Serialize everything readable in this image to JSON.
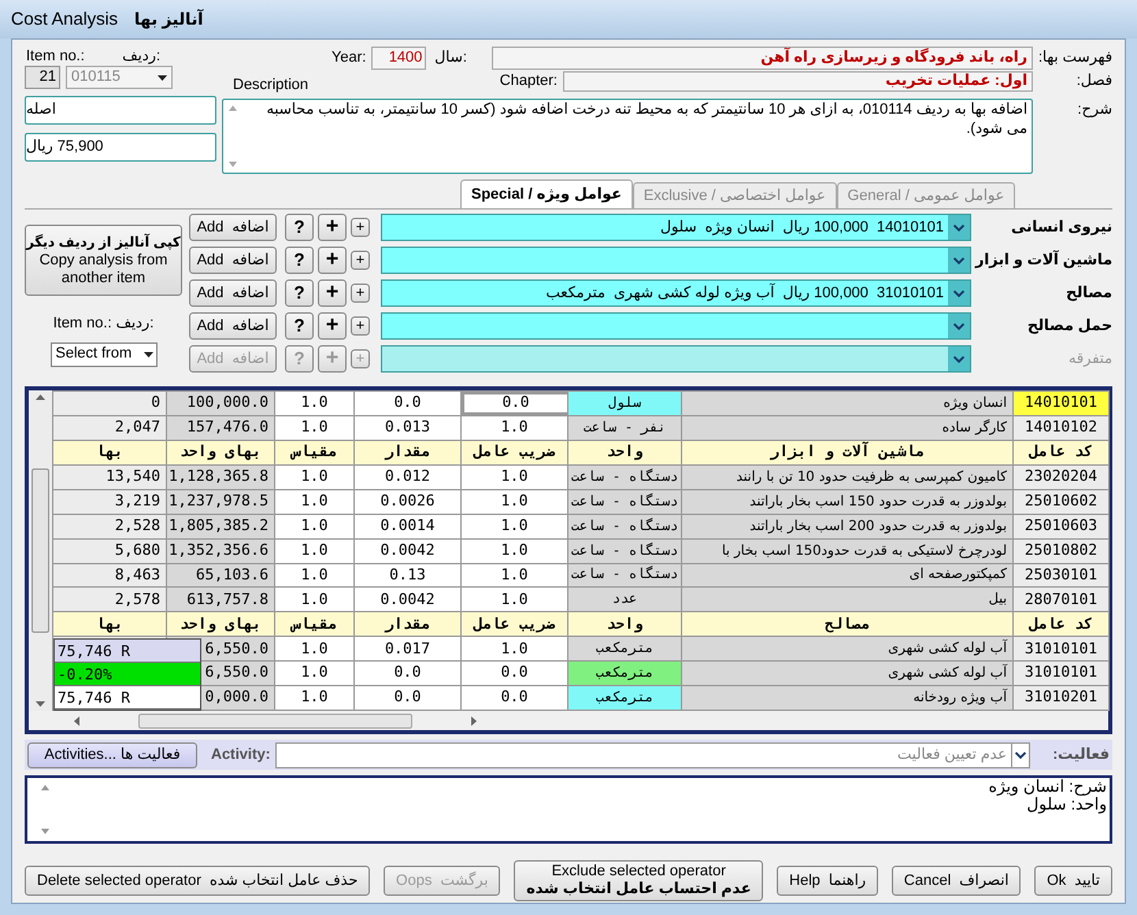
{
  "window": {
    "title_en": "Cost Analysis",
    "title_fa": "آنالیز بها"
  },
  "item": {
    "label_en": "Item no.:",
    "label_fa": "ردیف:",
    "index": "21",
    "code": "010115",
    "unit": "اصله",
    "price": "75,900 ریال"
  },
  "year": {
    "label_en": "Year:",
    "value": "1400",
    "label_fa": "سال:"
  },
  "catalog": {
    "label": "فهرست بها:",
    "value": "راه، باند فرودگاه و زیرسازی راه آهن"
  },
  "chapter": {
    "label_en": "Chapter:",
    "label": "فصل:",
    "value": "اول: عملیات تخریب"
  },
  "description": {
    "label_en": "Description",
    "label": "شرح:",
    "value": "اضافه بها به ردیف 010114، به ازای هر 10 سانتیمتر که به محیط تنه درخت اضافه شود (کسر 10 سانتیمتر، به تناسب محاسبه می شود)."
  },
  "tabs": [
    {
      "label": "General / عوامل عمومی",
      "selected": false
    },
    {
      "label": "Exclusive / عوامل اختصاصی",
      "selected": false
    },
    {
      "label": "Special / عوامل ویژه",
      "selected": true
    }
  ],
  "copy_panel": {
    "button_fa": "کپی آنالیز از ردیف دیگر",
    "button_en": "Copy analysis from another item",
    "item_label": "Item no.:  ردیف:",
    "select": "Select from"
  },
  "factors": [
    {
      "label": "نیروی انسانی",
      "value": "14010101  100,000 ریال  انسان ویژه  سلول",
      "disabled": false,
      "add": "Add  اضافه",
      "help": "?",
      "plus": "+",
      "plus_small": "+"
    },
    {
      "label": "ماشین آلات و ابزار",
      "disabled": false,
      "add": "Add  اضافه",
      "help": "?",
      "plus": "+",
      "plus_small": "+"
    },
    {
      "label": "مصالح",
      "value": "31010101  100,000 ریال  آب ویژه لوله کشی شهری  مترمکعب",
      "disabled": false,
      "add": "Add  اضافه",
      "help": "?",
      "plus": "+",
      "plus_small": "+"
    },
    {
      "label": "حمل مصالح",
      "disabled": false,
      "add": "Add  اضافه",
      "help": "?",
      "plus": "+",
      "plus_small": "+"
    },
    {
      "label": "متفرقه",
      "disabled": true,
      "add": "Add  اضافه",
      "help": "?",
      "plus": "+",
      "plus_small": "+"
    }
  ],
  "table": {
    "rows": [
      {
        "kind": "data",
        "selected": true,
        "color": "#80f8f8",
        "code": "14010101",
        "name": "انسان ویژه",
        "unit": "سلول",
        "factor": "0.0",
        "amount": "0.0",
        "scale": "1.0",
        "unit_price": "100,000.0",
        "price": "0"
      },
      {
        "kind": "data",
        "selected": false,
        "color": "#d8d8d8",
        "code": "14010102",
        "name": "کارگر ساده",
        "unit": "نفر - ساعت",
        "factor": "1.0",
        "amount": "0.013",
        "scale": "1.0",
        "unit_price": "157,476.0",
        "price": "2,047"
      },
      {
        "kind": "header",
        "code": "کد عامل",
        "name": "ماشین آلات و ابزار",
        "unit": "واحد",
        "factor": "ضریب عامل",
        "amount": "مقدار",
        "scale": "مقیاس",
        "unit_price": "بهای واحد",
        "price": "بها"
      },
      {
        "kind": "data",
        "selected": false,
        "color": "#d8d8d8",
        "code": "23020204",
        "name": "کامیون کمپرسی به ظرفیت حدود 10 تن با رانند",
        "unit": "دستگاه - ساعت",
        "factor": "1.0",
        "amount": "0.012",
        "scale": "1.0",
        "unit_price": "1,128,365.8",
        "price": "13,540"
      },
      {
        "kind": "data",
        "selected": false,
        "color": "#d8d8d8",
        "code": "25010602",
        "name": "بولدوزر به قدرت حدود 150 اسب بخار باراتند",
        "unit": "دستگاه - ساعت",
        "factor": "1.0",
        "amount": "0.0026",
        "scale": "1.0",
        "unit_price": "1,237,978.5",
        "price": "3,219"
      },
      {
        "kind": "data",
        "selected": false,
        "color": "#d8d8d8",
        "code": "25010603",
        "name": "بولدوزر به قدرت حدود 200 اسب بخار باراتند",
        "unit": "دستگاه - ساعت",
        "factor": "1.0",
        "amount": "0.0014",
        "scale": "1.0",
        "unit_price": "1,805,385.2",
        "price": "2,528"
      },
      {
        "kind": "data",
        "selected": false,
        "color": "#d8d8d8",
        "code": "25010802",
        "name": "لودرچرخ لاستیکی به قدرت حدود150 اسب بخار با",
        "unit": "دستگاه - ساعت",
        "factor": "1.0",
        "amount": "0.0042",
        "scale": "1.0",
        "unit_price": "1,352,356.6",
        "price": "5,680"
      },
      {
        "kind": "data",
        "selected": false,
        "color": "#d8d8d8",
        "code": "25030101",
        "name": "کمپکتورصفحه ای",
        "unit": "دستگاه - ساعت",
        "factor": "1.0",
        "amount": "0.13",
        "scale": "1.0",
        "unit_price": "65,103.6",
        "price": "8,463"
      },
      {
        "kind": "data",
        "selected": false,
        "color": "#d8d8d8",
        "code": "28070101",
        "name": "بیل",
        "unit": "عدد",
        "factor": "1.0",
        "amount": "0.0042",
        "scale": "1.0",
        "unit_price": "613,757.8",
        "price": "2,578"
      },
      {
        "kind": "header",
        "code": "کد عامل",
        "name": "مصالح",
        "unit": "واحد",
        "factor": "ضریب عامل",
        "amount": "مقدار",
        "scale": "مقیاس",
        "unit_price": "بهای واحد",
        "price": "بها"
      },
      {
        "kind": "data",
        "selected": false,
        "color": "#d8d8d8",
        "code": "31010101",
        "name": "آب لوله کشی شهری",
        "unit": "مترمکعب",
        "factor": "1.0",
        "amount": "0.017",
        "scale": "1.0",
        "unit_price": "6,550.0"
      },
      {
        "kind": "data",
        "selected": false,
        "color": "#80f080",
        "code": "31010101",
        "name": "آب لوله کشی شهری",
        "unit": "مترمکعب",
        "factor": "0.0",
        "amount": "0.0",
        "scale": "1.0",
        "unit_price": "6,550.0"
      },
      {
        "kind": "data",
        "selected": false,
        "color": "#80f8f8",
        "code": "31010201",
        "name": "آب ویژه رودخانه",
        "unit": "مترمکعب",
        "factor": "0.0",
        "amount": "0.0",
        "scale": "1.0",
        "unit_price": "0,000.0"
      }
    ]
  },
  "summary_popup": [
    {
      "text": "75,746 R",
      "color": "#d8d8f0"
    },
    {
      "text": "-0.20%",
      "color": "#00e000"
    },
    {
      "text": "75,746 R",
      "color": "#ffffff"
    }
  ],
  "activity": {
    "button": "Activities... فعالیت ها",
    "label_en": "Activity:",
    "value": "عدم تعیین فعالیت",
    "label": "فعالیت:"
  },
  "notes": [
    "شرح: انسان ویژه",
    "واحد: سلول"
  ],
  "buttons": [
    {
      "lines": [
        "Ok  تایید"
      ],
      "disabled": false
    },
    {
      "lines": [
        "Cancel  انصراف"
      ],
      "disabled": false
    },
    {
      "lines": [
        "Help  راهنما"
      ],
      "disabled": false
    },
    {
      "lines": [
        "Exclude selected operator",
        "عدم احتساب عامل انتخاب شده"
      ],
      "disabled": false
    },
    {
      "lines": [
        "Oops  برگشت"
      ],
      "disabled": true
    },
    {
      "lines": [
        "Delete selected operator  حذف عامل انتخاب شده"
      ],
      "disabled": false
    }
  ]
}
